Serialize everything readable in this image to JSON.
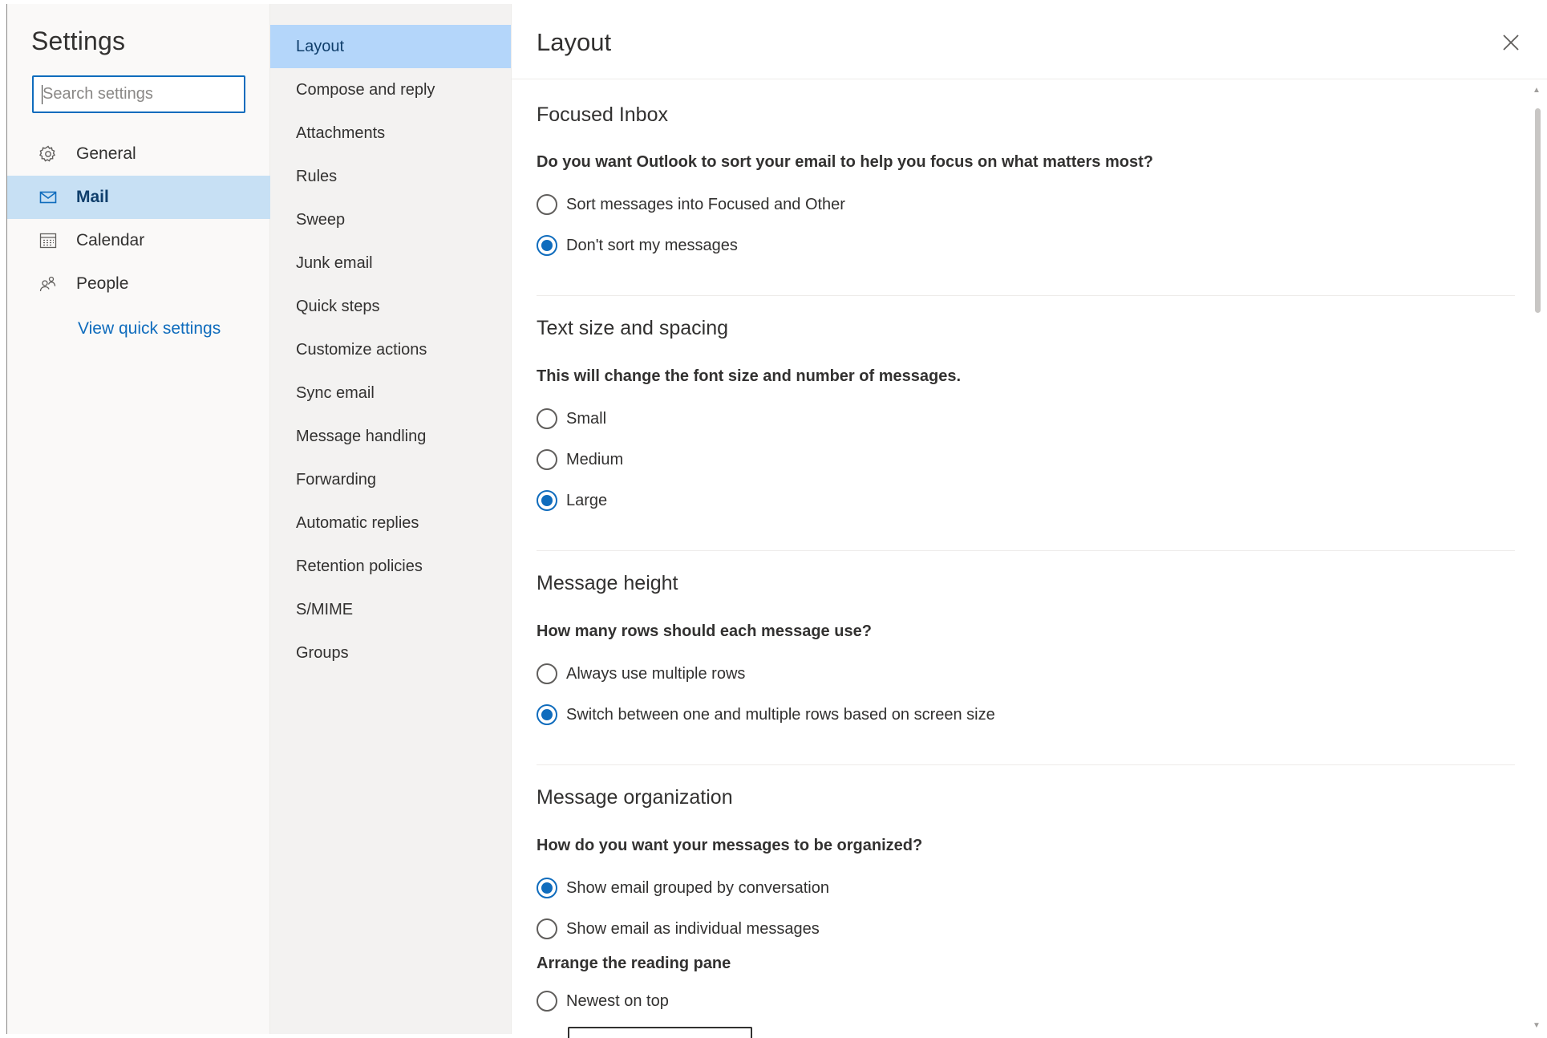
{
  "settings_panel": {
    "title": "Settings",
    "search_placeholder": "Search settings",
    "categories": [
      {
        "label": "General",
        "icon": "gear-icon",
        "active": false
      },
      {
        "label": "Mail",
        "icon": "mail-icon",
        "active": true
      },
      {
        "label": "Calendar",
        "icon": "calendar-icon",
        "active": false
      },
      {
        "label": "People",
        "icon": "people-icon",
        "active": false
      }
    ],
    "quick_settings_link": "View quick settings"
  },
  "mail_subsections": [
    {
      "label": "Layout",
      "active": true
    },
    {
      "label": "Compose and reply"
    },
    {
      "label": "Attachments"
    },
    {
      "label": "Rules"
    },
    {
      "label": "Sweep"
    },
    {
      "label": "Junk email"
    },
    {
      "label": "Quick steps"
    },
    {
      "label": "Customize actions"
    },
    {
      "label": "Sync email"
    },
    {
      "label": "Message handling"
    },
    {
      "label": "Forwarding"
    },
    {
      "label": "Automatic replies"
    },
    {
      "label": "Retention policies"
    },
    {
      "label": "S/MIME"
    },
    {
      "label": "Groups"
    }
  ],
  "main": {
    "title": "Layout",
    "close_icon": "close-icon",
    "sections": {
      "focused_inbox": {
        "title": "Focused Inbox",
        "question": "Do you want Outlook to sort your email to help you focus on what matters most?",
        "options": [
          "Sort messages into Focused and Other",
          "Don't sort my messages"
        ],
        "selected": "Don't sort my messages"
      },
      "text_size": {
        "title": "Text size and spacing",
        "question": "This will change the font size and number of messages.",
        "options": [
          "Small",
          "Medium",
          "Large"
        ],
        "selected": "Large"
      },
      "message_height": {
        "title": "Message height",
        "question": "How many rows should each message use?",
        "options": [
          "Always use multiple rows",
          "Switch between one and multiple rows based on screen size"
        ],
        "selected": "Switch between one and multiple rows based on screen size"
      },
      "message_organization": {
        "title": "Message organization",
        "question": "How do you want your messages to be organized?",
        "options": [
          "Show email grouped by conversation",
          "Show email as individual messages"
        ],
        "selected": "Show email grouped by conversation",
        "reading_pane_label": "Arrange the reading pane",
        "reading_pane_options": [
          "Newest on top"
        ]
      }
    }
  },
  "colors": {
    "accent": "#0f6cbd",
    "active_category_bg": "#c7e0f4",
    "active_subsection_bg": "#b4d6fa"
  }
}
